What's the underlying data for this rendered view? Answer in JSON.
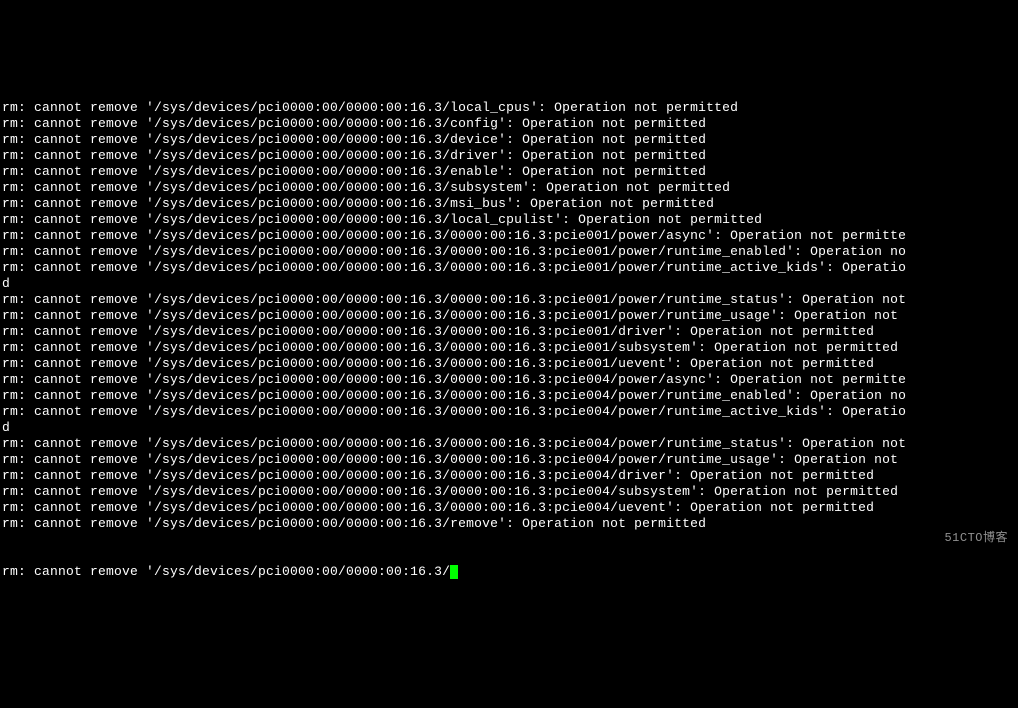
{
  "lines": [
    "rm: cannot remove '/sys/devices/pci0000:00/0000:00:16.3/local_cpus': Operation not permitted",
    "rm: cannot remove '/sys/devices/pci0000:00/0000:00:16.3/config': Operation not permitted",
    "rm: cannot remove '/sys/devices/pci0000:00/0000:00:16.3/device': Operation not permitted",
    "rm: cannot remove '/sys/devices/pci0000:00/0000:00:16.3/driver': Operation not permitted",
    "rm: cannot remove '/sys/devices/pci0000:00/0000:00:16.3/enable': Operation not permitted",
    "rm: cannot remove '/sys/devices/pci0000:00/0000:00:16.3/subsystem': Operation not permitted",
    "rm: cannot remove '/sys/devices/pci0000:00/0000:00:16.3/msi_bus': Operation not permitted",
    "rm: cannot remove '/sys/devices/pci0000:00/0000:00:16.3/local_cpulist': Operation not permitted",
    "rm: cannot remove '/sys/devices/pci0000:00/0000:00:16.3/0000:00:16.3:pcie001/power/async': Operation not permitte",
    "rm: cannot remove '/sys/devices/pci0000:00/0000:00:16.3/0000:00:16.3:pcie001/power/runtime_enabled': Operation no",
    "rm: cannot remove '/sys/devices/pci0000:00/0000:00:16.3/0000:00:16.3:pcie001/power/runtime_active_kids': Operatio",
    "d",
    "rm: cannot remove '/sys/devices/pci0000:00/0000:00:16.3/0000:00:16.3:pcie001/power/runtime_status': Operation not",
    "rm: cannot remove '/sys/devices/pci0000:00/0000:00:16.3/0000:00:16.3:pcie001/power/runtime_usage': Operation not ",
    "rm: cannot remove '/sys/devices/pci0000:00/0000:00:16.3/0000:00:16.3:pcie001/driver': Operation not permitted",
    "rm: cannot remove '/sys/devices/pci0000:00/0000:00:16.3/0000:00:16.3:pcie001/subsystem': Operation not permitted",
    "rm: cannot remove '/sys/devices/pci0000:00/0000:00:16.3/0000:00:16.3:pcie001/uevent': Operation not permitted",
    "rm: cannot remove '/sys/devices/pci0000:00/0000:00:16.3/0000:00:16.3:pcie004/power/async': Operation not permitte",
    "rm: cannot remove '/sys/devices/pci0000:00/0000:00:16.3/0000:00:16.3:pcie004/power/runtime_enabled': Operation no",
    "rm: cannot remove '/sys/devices/pci0000:00/0000:00:16.3/0000:00:16.3:pcie004/power/runtime_active_kids': Operatio",
    "d",
    "rm: cannot remove '/sys/devices/pci0000:00/0000:00:16.3/0000:00:16.3:pcie004/power/runtime_status': Operation not",
    "rm: cannot remove '/sys/devices/pci0000:00/0000:00:16.3/0000:00:16.3:pcie004/power/runtime_usage': Operation not ",
    "rm: cannot remove '/sys/devices/pci0000:00/0000:00:16.3/0000:00:16.3:pcie004/driver': Operation not permitted",
    "rm: cannot remove '/sys/devices/pci0000:00/0000:00:16.3/0000:00:16.3:pcie004/subsystem': Operation not permitted",
    "rm: cannot remove '/sys/devices/pci0000:00/0000:00:16.3/0000:00:16.3:pcie004/uevent': Operation not permitted",
    "rm: cannot remove '/sys/devices/pci0000:00/0000:00:16.3/remove': Operation not permitted"
  ],
  "lastLinePrefix": "rm: cannot remove '/sys/devices/pci0000:00/0000:00:16.3/",
  "watermark": "51CTO博客"
}
